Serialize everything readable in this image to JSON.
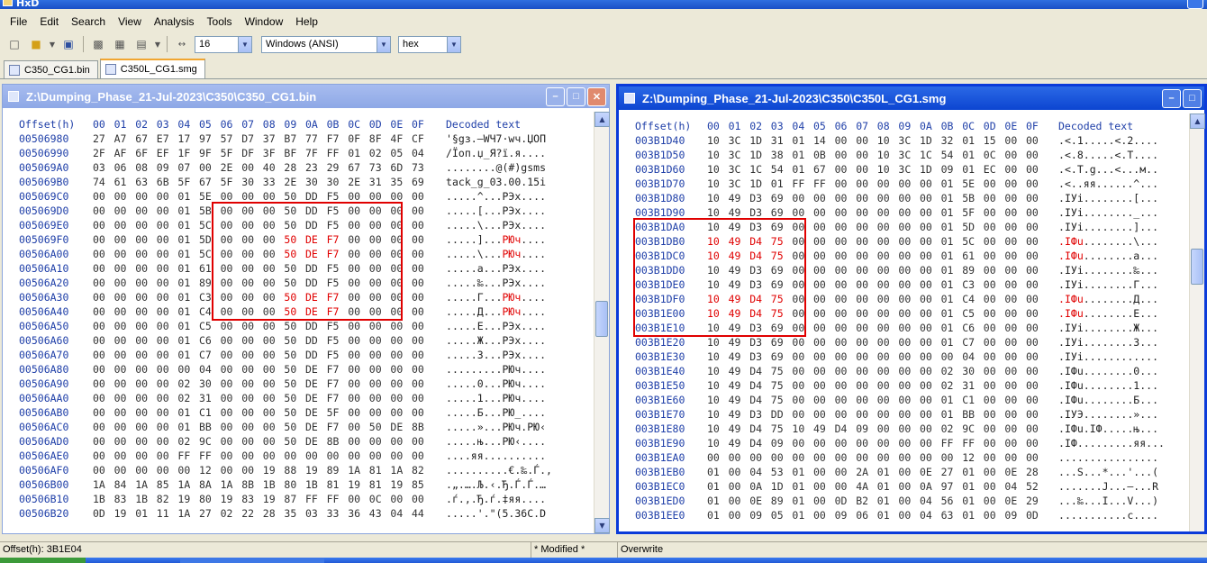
{
  "app": {
    "title": "HxD"
  },
  "menu": [
    "File",
    "Edit",
    "Search",
    "View",
    "Analysis",
    "Tools",
    "Window",
    "Help"
  ],
  "toolbar": {
    "bytes_per_row": "16",
    "charset": "Windows (ANSI)",
    "display_mode": "hex"
  },
  "tabs": [
    {
      "label": "C350_CG1.bin",
      "active": false
    },
    {
      "label": "C350L_CG1.smg",
      "active": true
    }
  ],
  "headers": {
    "offset": "Offset(h)",
    "cols": [
      "00",
      "01",
      "02",
      "03",
      "04",
      "05",
      "06",
      "07",
      "08",
      "09",
      "0A",
      "0B",
      "0C",
      "0D",
      "0E",
      "0F"
    ],
    "decoded": "Decoded text"
  },
  "left_pane": {
    "title": "Z:\\Dumping_Phase_21-Jul-2023\\C350\\C350_CG1.bin",
    "rows": [
      {
        "off": "00506980",
        "bytes": "27 A7 67 E7 17 97 57 D7 37 B7 77 F7 0F 8F 4F CF",
        "text": "'§gз.—WЧ7·wч.ЏОП"
      },
      {
        "off": "00506990",
        "bytes": "2F AF 6F EF 1F 9F 5F DF 3F BF 7F FF 01 02 05 04",
        "text": "/Їоп.џ_Я?ї.я...."
      },
      {
        "off": "005069A0",
        "bytes": "03 06 08 09 07 00 2E 00 40 28 23 29 67 73 6D 73",
        "text": "........@(#)gsms"
      },
      {
        "off": "005069B0",
        "bytes": "74 61 63 6B 5F 67 5F 30 33 2E 30 30 2E 31 35 69",
        "text": "tack_g_03.00.15i"
      },
      {
        "off": "005069C0",
        "bytes": "00 00 00 00 01 5E 00 00 00 50 DD F5 00 00 00 00",
        "text": ".....^...PЭх...."
      },
      {
        "off": "005069D0",
        "bytes": "00 00 00 00 01 5B 00 00 00 50 DD F5 00 00 00 00",
        "text": ".....[...PЭх...."
      },
      {
        "off": "005069E0",
        "bytes": "00 00 00 00 01 5C 00 00 00 50 DD F5 00 00 00 00",
        "text": ".....\\...PЭх...."
      },
      {
        "off": "005069F0",
        "bytes": "00 00 00 00 01 5D 00 00 00 50 DE F7 00 00 00 00",
        "text": ".....]...PЮч....",
        "hl": [
          9,
          10,
          11
        ]
      },
      {
        "off": "00506A00",
        "bytes": "00 00 00 00 01 5C 00 00 00 50 DE F7 00 00 00 00",
        "text": ".....\\...PЮч....",
        "hl": [
          9,
          10,
          11
        ]
      },
      {
        "off": "00506A10",
        "bytes": "00 00 00 00 01 61 00 00 00 50 DD F5 00 00 00 00",
        "text": ".....a...PЭх...."
      },
      {
        "off": "00506A20",
        "bytes": "00 00 00 00 01 89 00 00 00 50 DD F5 00 00 00 00",
        "text": ".....‰...PЭх...."
      },
      {
        "off": "00506A30",
        "bytes": "00 00 00 00 01 C3 00 00 00 50 DE F7 00 00 00 00",
        "text": ".....Г...PЮч....",
        "hl": [
          9,
          10,
          11
        ]
      },
      {
        "off": "00506A40",
        "bytes": "00 00 00 00 01 C4 00 00 00 50 DE F7 00 00 00 00",
        "text": ".....Д...PЮч....",
        "hl": [
          9,
          10,
          11
        ]
      },
      {
        "off": "00506A50",
        "bytes": "00 00 00 00 01 C5 00 00 00 50 DD F5 00 00 00 00",
        "text": ".....Е...PЭх...."
      },
      {
        "off": "00506A60",
        "bytes": "00 00 00 00 01 C6 00 00 00 50 DD F5 00 00 00 00",
        "text": ".....Ж...PЭх...."
      },
      {
        "off": "00506A70",
        "bytes": "00 00 00 00 01 C7 00 00 00 50 DD F5 00 00 00 00",
        "text": ".....З...PЭх...."
      },
      {
        "off": "00506A80",
        "bytes": "00 00 00 00 00 04 00 00 00 50 DE F7 00 00 00 00",
        "text": ".........PЮч...."
      },
      {
        "off": "00506A90",
        "bytes": "00 00 00 00 02 30 00 00 00 50 DE F7 00 00 00 00",
        "text": ".....0...PЮч...."
      },
      {
        "off": "00506AA0",
        "bytes": "00 00 00 00 02 31 00 00 00 50 DE F7 00 00 00 00",
        "text": ".....1...PЮч...."
      },
      {
        "off": "00506AB0",
        "bytes": "00 00 00 00 01 C1 00 00 00 50 DE 5F 00 00 00 00",
        "text": ".....Б...PЮ_...."
      },
      {
        "off": "00506AC0",
        "bytes": "00 00 00 00 01 BB 00 00 00 50 DE F7 00 50 DE 8B",
        "text": ".....»...PЮч.PЮ‹"
      },
      {
        "off": "00506AD0",
        "bytes": "00 00 00 00 02 9C 00 00 00 50 DE 8B 00 00 00 00",
        "text": ".....њ...PЮ‹...."
      },
      {
        "off": "00506AE0",
        "bytes": "00 00 00 00 FF FF 00 00 00 00 00 00 00 00 00 00",
        "text": "....яя.........."
      },
      {
        "off": "00506AF0",
        "bytes": "00 00 00 00 00 12 00 00 19 88 19 89 1A 81 1A 82",
        "text": "..........€.‰.Ѓ.‚"
      },
      {
        "off": "00506B00",
        "bytes": "1A 84 1A 85 1A 8A 1A 8B 1B 80 1B 81 19 81 19 85",
        "text": ".„.….Љ.‹.Ђ.Ѓ.Ѓ.…"
      },
      {
        "off": "00506B10",
        "bytes": "1B 83 1B 82 19 80 19 83 19 87 FF FF 00 0C 00 00",
        "text": ".ѓ.‚.Ђ.ѓ.‡яя...."
      },
      {
        "off": "00506B20",
        "bytes": "0D 19 01 11 1A 27 02 22 28 35 03 33 36 43 04 44",
        "text": ".....'.\"(5.36C.D"
      }
    ]
  },
  "right_pane": {
    "title": "Z:\\Dumping_Phase_21-Jul-2023\\C350\\C350L_CG1.smg",
    "rows": [
      {
        "off": "003B1D40",
        "bytes": "10 3C 1D 31 01 14 00 00 10 3C 1D 32 01 15 00 00",
        "text": ".<.1.....<.2...."
      },
      {
        "off": "003B1D50",
        "bytes": "10 3C 1D 38 01 0B 00 00 10 3C 1C 54 01 0C 00 00",
        "text": ".<.8.....<.T...."
      },
      {
        "off": "003B1D60",
        "bytes": "10 3C 1C 54 01 67 00 00 10 3C 1D 09 01 EC 00 00",
        "text": ".<.T.g...<...м.."
      },
      {
        "off": "003B1D70",
        "bytes": "10 3C 1D 01 FF FF 00 00 00 00 00 01 5E 00 00 00",
        "text": ".<..яя......^..."
      },
      {
        "off": "003B1D80",
        "bytes": "10 49 D3 69 00 00 00 00 00 00 00 01 5B 00 00 00",
        "text": ".IУi........[..."
      },
      {
        "off": "003B1D90",
        "bytes": "10 49 D3 69 00 00 00 00 00 00 00 01 5F 00 00 00",
        "text": ".IУi........_..."
      },
      {
        "off": "003B1DA0",
        "bytes": "10 49 D3 69 00 00 00 00 00 00 00 01 5D 00 00 00",
        "text": ".IУi........]..."
      },
      {
        "off": "003B1DB0",
        "bytes": "10 49 D4 75 00 00 00 00 00 00 00 01 5C 00 00 00",
        "text": ".IФu........\\...",
        "hl": [
          0,
          1,
          2,
          3
        ]
      },
      {
        "off": "003B1DC0",
        "bytes": "10 49 D4 75 00 00 00 00 00 00 00 01 61 00 00 00",
        "text": ".IФu........a...",
        "hl": [
          0,
          1,
          2,
          3
        ]
      },
      {
        "off": "003B1DD0",
        "bytes": "10 49 D3 69 00 00 00 00 00 00 00 01 89 00 00 00",
        "text": ".IУi........‰..."
      },
      {
        "off": "003B1DE0",
        "bytes": "10 49 D3 69 00 00 00 00 00 00 00 01 C3 00 00 00",
        "text": ".IУi........Г..."
      },
      {
        "off": "003B1DF0",
        "bytes": "10 49 D4 75 00 00 00 00 00 00 00 01 C4 00 00 00",
        "text": ".IФu........Д...",
        "hl": [
          0,
          1,
          2,
          3
        ]
      },
      {
        "off": "003B1E00",
        "bytes": "10 49 D4 75 00 00 00 00 00 00 00 01 C5 00 00 00",
        "text": ".IФu........Е...",
        "hl": [
          0,
          1,
          2,
          3
        ]
      },
      {
        "off": "003B1E10",
        "bytes": "10 49 D3 69 00 00 00 00 00 00 00 01 C6 00 00 00",
        "text": ".IУi........Ж..."
      },
      {
        "off": "003B1E20",
        "bytes": "10 49 D3 69 00 00 00 00 00 00 00 01 C7 00 00 00",
        "text": ".IУi........З..."
      },
      {
        "off": "003B1E30",
        "bytes": "10 49 D3 69 00 00 00 00 00 00 00 00 04 00 00 00",
        "text": ".IУi............"
      },
      {
        "off": "003B1E40",
        "bytes": "10 49 D4 75 00 00 00 00 00 00 00 02 30 00 00 00",
        "text": ".IФu........0..."
      },
      {
        "off": "003B1E50",
        "bytes": "10 49 D4 75 00 00 00 00 00 00 00 02 31 00 00 00",
        "text": ".IФu........1..."
      },
      {
        "off": "003B1E60",
        "bytes": "10 49 D4 75 00 00 00 00 00 00 00 01 C1 00 00 00",
        "text": ".IФu........Б..."
      },
      {
        "off": "003B1E70",
        "bytes": "10 49 D3 DD 00 00 00 00 00 00 00 01 BB 00 00 00",
        "text": ".IУЭ........»..."
      },
      {
        "off": "003B1E80",
        "bytes": "10 49 D4 75 10 49 D4 09 00 00 00 02 9C 00 00 00",
        "text": ".IФu.IФ.....њ..."
      },
      {
        "off": "003B1E90",
        "bytes": "10 49 D4 09 00 00 00 00 00 00 00 FF FF 00 00 00",
        "text": ".IФ.........яя..."
      },
      {
        "off": "003B1EA0",
        "bytes": "00 00 00 00 00 00 00 00 00 00 00 00 12 00 00 00",
        "text": "................"
      },
      {
        "off": "003B1EB0",
        "bytes": "01 00 04 53 01 00 00 2A 01 00 0E 27 01 00 0E 28",
        "text": "...S...*...'...("
      },
      {
        "off": "003B1EC0",
        "bytes": "01 00 0A 1D 01 00 00 4A 01 00 0A 97 01 00 04 52",
        "text": ".......J...—...R"
      },
      {
        "off": "003B1ED0",
        "bytes": "01 00 0E 89 01 00 0D B2 01 00 04 56 01 00 0E 29",
        "text": "...‰...І...V...)"
      },
      {
        "off": "003B1EE0",
        "bytes": "01 00 09 05 01 00 09 06 01 00 04 63 01 00 09 0D",
        "text": "...........c...."
      }
    ]
  },
  "status": {
    "offset": "Offset(h): 3B1E04",
    "modified": "* Modified *",
    "mode": "Overwrite"
  }
}
